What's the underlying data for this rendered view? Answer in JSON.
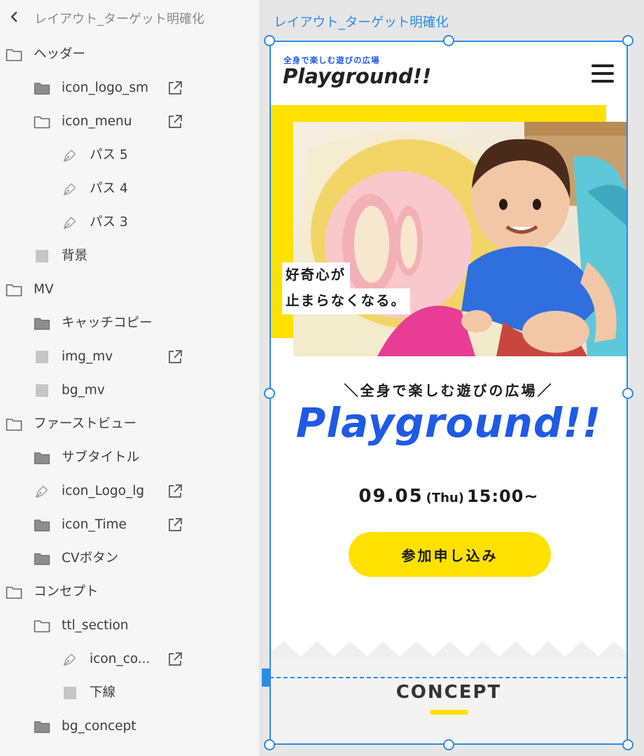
{
  "layers_panel": {
    "title": "レイアウト_ターゲット明確化",
    "items": [
      {
        "label": "ヘッダー",
        "icon": "folder-outline-icon"
      },
      {
        "label": "icon_logo_sm",
        "icon": "folder-filled-icon",
        "linked": true
      },
      {
        "label": "icon_menu",
        "icon": "folder-outline-icon",
        "linked": true
      },
      {
        "label": "パス 5",
        "icon": "pen-path-icon"
      },
      {
        "label": "パス 4",
        "icon": "pen-path-icon"
      },
      {
        "label": "パス 3",
        "icon": "pen-path-icon"
      },
      {
        "label": "背景",
        "icon": "rectangle-icon"
      },
      {
        "label": "MV",
        "icon": "folder-outline-icon"
      },
      {
        "label": "キャッチコピー",
        "icon": "folder-filled-icon"
      },
      {
        "label": "img_mv",
        "icon": "rectangle-icon",
        "linked": true
      },
      {
        "label": "bg_mv",
        "icon": "rectangle-icon"
      },
      {
        "label": "ファーストビュー",
        "icon": "folder-outline-icon"
      },
      {
        "label": "サブタイトル",
        "icon": "folder-filled-icon"
      },
      {
        "label": "icon_Logo_lg",
        "icon": "pen-path-icon",
        "linked": true
      },
      {
        "label": "icon_Time",
        "icon": "folder-filled-icon",
        "linked": true
      },
      {
        "label": "CVボタン",
        "icon": "folder-filled-icon"
      },
      {
        "label": "コンセプト",
        "icon": "folder-outline-icon"
      },
      {
        "label": "ttl_section",
        "icon": "folder-outline-icon"
      },
      {
        "label": "icon_co...",
        "icon": "pen-path-icon",
        "linked": true
      },
      {
        "label": "下線",
        "icon": "rectangle-icon"
      },
      {
        "label": "bg_concept",
        "icon": "folder-filled-icon"
      }
    ]
  },
  "canvas": {
    "artboard_name": "レイアウト_ターゲット明確化"
  },
  "site": {
    "header": {
      "logo_sub": "全身で楽しむ遊びの広場",
      "logo_main": "Playground!!"
    },
    "mv": {
      "catch_line1": "好奇心が",
      "catch_line2": "止まらなくなる。"
    },
    "first_view": {
      "subtitle": "＼全身で楽しむ遊びの広場／",
      "logo": "Playground!!",
      "date": "09.05",
      "day_of_week": "(Thu)",
      "time": "15:00~",
      "cv_button": "参加申し込み"
    },
    "concept": {
      "title": "CONCEPT"
    }
  },
  "colors": {
    "accent_blue": "#1f5ae6",
    "selection_blue": "#2b8be6",
    "brand_yellow": "#ffe100"
  }
}
